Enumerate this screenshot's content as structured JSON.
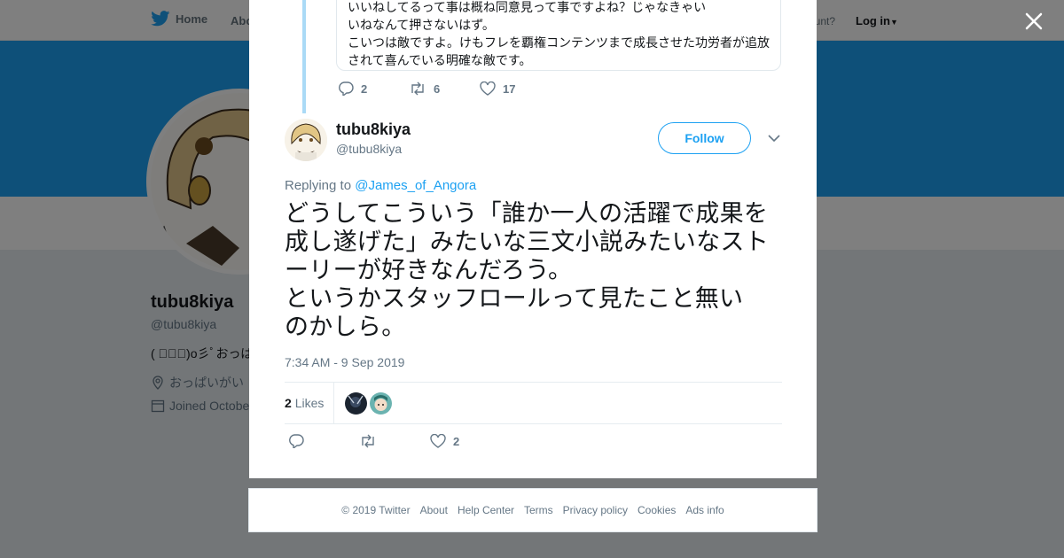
{
  "nav": {
    "home_label": "Home",
    "about_label": "Abo",
    "account_prompt": "ccount?",
    "login_label": "Log in"
  },
  "profile": {
    "name": "tubu8kiya",
    "handle": "@tubu8kiya",
    "bio": "( ﾟ∀ﾟ)o彡ﾟおっぱ",
    "location": "おっぱいがい",
    "joined": "Joined Octobe"
  },
  "parent_tweet": {
    "lines": [
      "いいねしてるって事は概ね同意見って事ですよね？じゃなきゃい",
      "いねなんて押さないはず。",
      "こいつは敵ですよ。けもフレを覇権コンテンツまで成長させた功労者が追放",
      "されて喜んでいる明確な敵です。"
    ],
    "replies": "2",
    "retweets": "6",
    "likes": "17"
  },
  "tweet": {
    "name": "tubu8kiya",
    "handle": "@tubu8kiya",
    "follow_label": "Follow",
    "replying_prefix": "Replying to",
    "replying_to": "@James_of_Angora",
    "text_lines": [
      "どうしてこういう「誰か一人の活躍で成果を",
      "成し遂げた」みたいな三文小説みたいなスト",
      "ーリーが好きなんだろう。",
      "というかスタッフロールって見たこと無い",
      "のかしら。"
    ],
    "timestamp": "7:34 AM - 9 Sep 2019",
    "likes_count": "2",
    "likes_label": "Likes",
    "action_likes": "2"
  },
  "footer": {
    "links": [
      "© 2019 Twitter",
      "About",
      "Help Center",
      "Terms",
      "Privacy policy",
      "Cookies",
      "Ads info"
    ]
  },
  "colors": {
    "brand": "#1da1f2",
    "muted": "#657786"
  }
}
